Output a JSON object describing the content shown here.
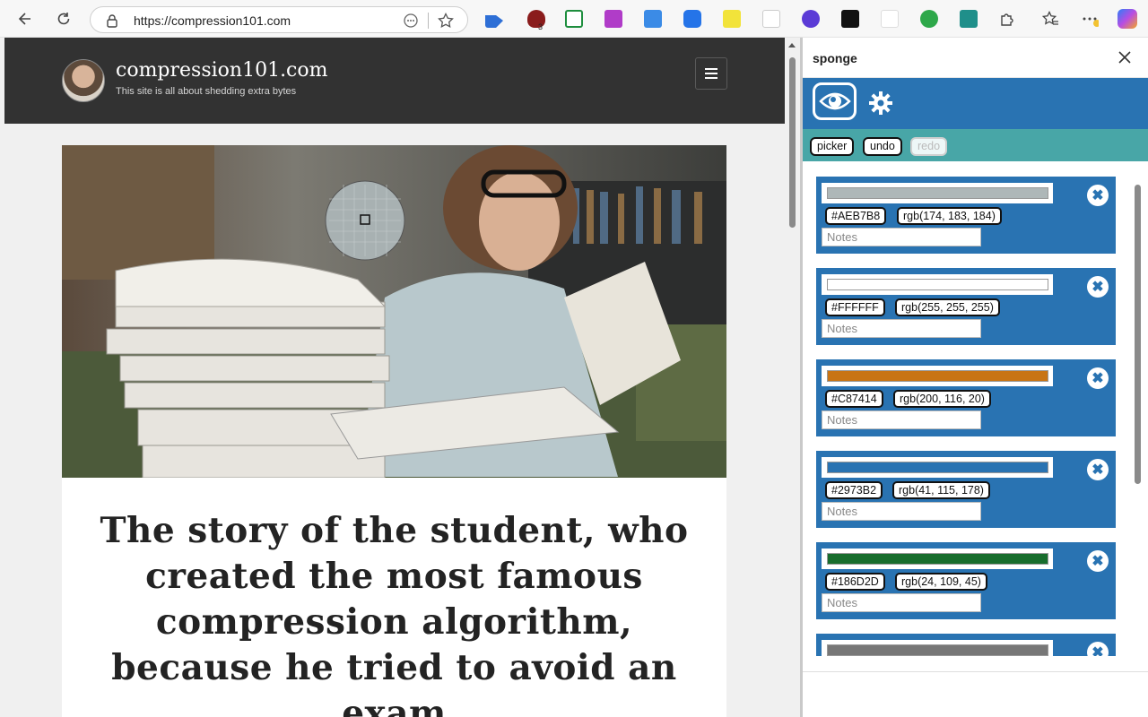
{
  "browser": {
    "url": "https://compression101.com",
    "ublock_badge": "3"
  },
  "site": {
    "title": "compression101.com",
    "tagline": "This site is all about shedding extra bytes"
  },
  "article": {
    "title": "The story of the student, who created the most famous compression algorithm, because he tried to avoid an exam"
  },
  "panel": {
    "title": "sponge",
    "buttons": {
      "picker": "picker",
      "undo": "undo",
      "redo": "redo"
    },
    "swatches": [
      {
        "hex": "#AEB7B8",
        "rgb": "rgb(174, 183, 184)",
        "notes_placeholder": "Notes"
      },
      {
        "hex": "#FFFFFF",
        "rgb": "rgb(255, 255, 255)",
        "notes_placeholder": "Notes"
      },
      {
        "hex": "#C87414",
        "rgb": "rgb(200, 116, 20)",
        "notes_placeholder": "Notes"
      },
      {
        "hex": "#2973B2",
        "rgb": "rgb(41, 115, 178)",
        "notes_placeholder": "Notes"
      },
      {
        "hex": "#186D2D",
        "rgb": "rgb(24, 109, 45)",
        "notes_placeholder": "Notes"
      }
    ],
    "partial_swatch_color": "#777777"
  },
  "colors": {
    "panel_blue": "#2973B2",
    "panel_teal": "#48A6A7",
    "site_header": "#323232"
  }
}
